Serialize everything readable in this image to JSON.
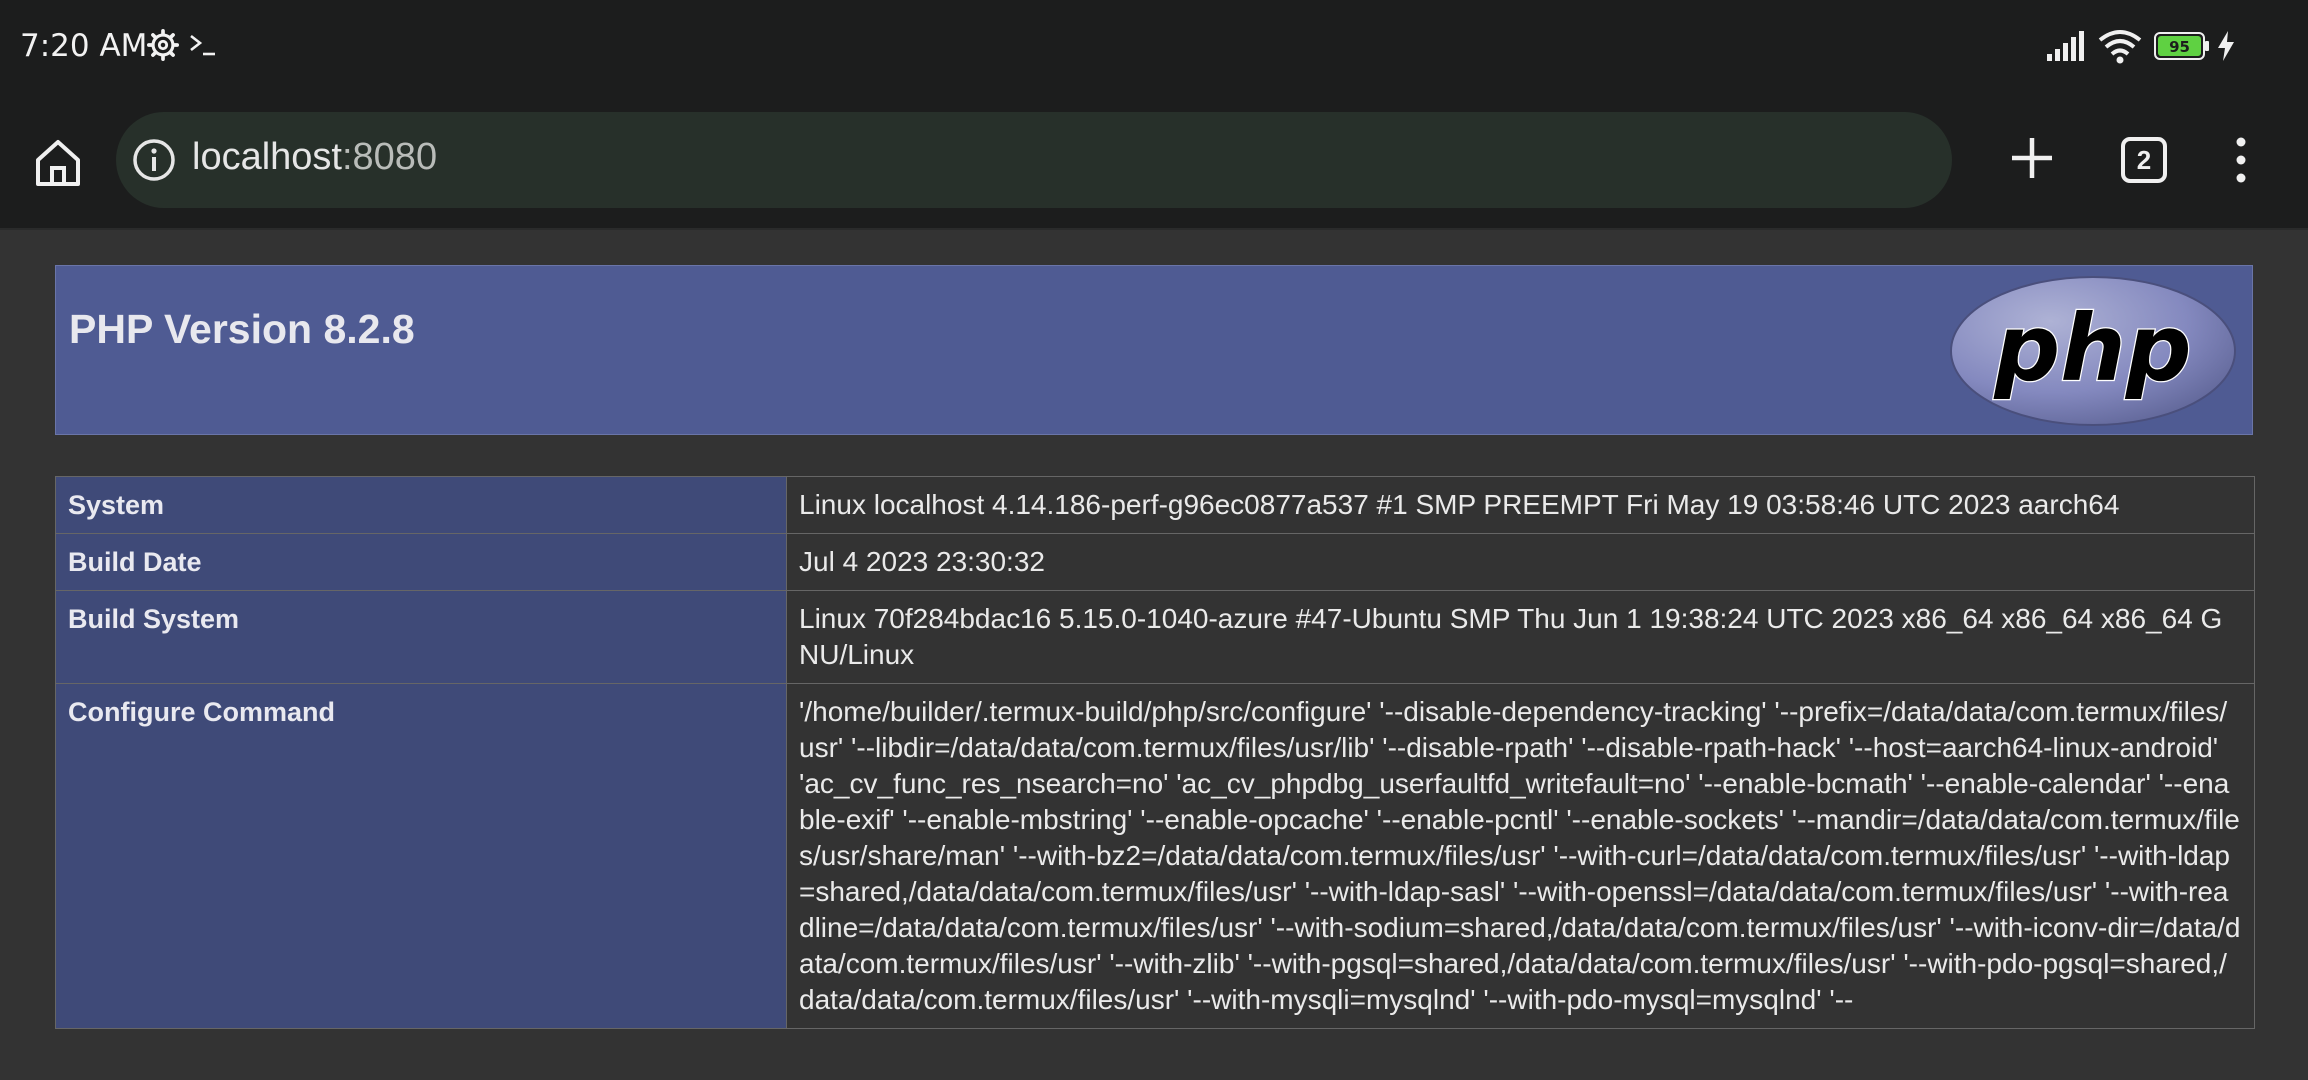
{
  "status_bar": {
    "time": "7:20 AM",
    "battery_level": "95",
    "icons": [
      "gear-icon",
      "terminal-icon",
      "signal-icon",
      "wifi-icon",
      "battery-icon",
      "charging-icon"
    ]
  },
  "browser": {
    "url_host": "localhost",
    "url_port": ":8080",
    "tab_count": "2",
    "icons": [
      "home-icon",
      "info-icon",
      "plus-icon",
      "tabs-icon",
      "more-vert-icon"
    ]
  },
  "php": {
    "title": "PHP Version 8.2.8",
    "logo_text": "php"
  },
  "info_rows": [
    {
      "key": "System",
      "value": "Linux localhost 4.14.186-perf-g96ec0877a537 #1 SMP PREEMPT Fri May 19 03:58:46 UTC 2023 aarch64"
    },
    {
      "key": "Build Date",
      "value": "Jul 4 2023 23:30:32"
    },
    {
      "key": "Build System",
      "value": "Linux 70f284bdac16 5.15.0-1040-azure #47-Ubuntu SMP Thu Jun 1 19:38:24 UTC 2023 x86_64 x86_64 x86_64 GNU/Linux"
    },
    {
      "key": "Configure Command",
      "value": "'/home/builder/.termux-build/php/src/configure' '--disable-dependency-tracking' '--prefix=/data/data/com.termux/files/usr' '--libdir=/data/data/com.termux/files/usr/lib' '--disable-rpath' '--disable-rpath-hack' '--host=aarch64-linux-android' 'ac_cv_func_res_nsearch=no' 'ac_cv_phpdbg_userfaultfd_writefault=no' '--enable-bcmath' '--enable-calendar' '--enable-exif' '--enable-mbstring' '--enable-opcache' '--enable-pcntl' '--enable-sockets' '--mandir=/data/data/com.termux/files/usr/share/man' '--with-bz2=/data/data/com.termux/files/usr' '--with-curl=/data/data/com.termux/files/usr' '--with-ldap=shared,/data/data/com.termux/files/usr' '--with-ldap-sasl' '--with-openssl=/data/data/com.termux/files/usr' '--with-readline=/data/data/com.termux/files/usr' '--with-sodium=shared,/data/data/com.termux/files/usr' '--with-iconv-dir=/data/data/com.termux/files/usr' '--with-zlib' '--with-pgsql=shared,/data/data/com.termux/files/usr' '--with-pdo-pgsql=shared,/data/data/com.termux/files/usr' '--with-mysqli=mysqlnd' '--with-pdo-mysql=mysqlnd' '--"
    }
  ]
}
